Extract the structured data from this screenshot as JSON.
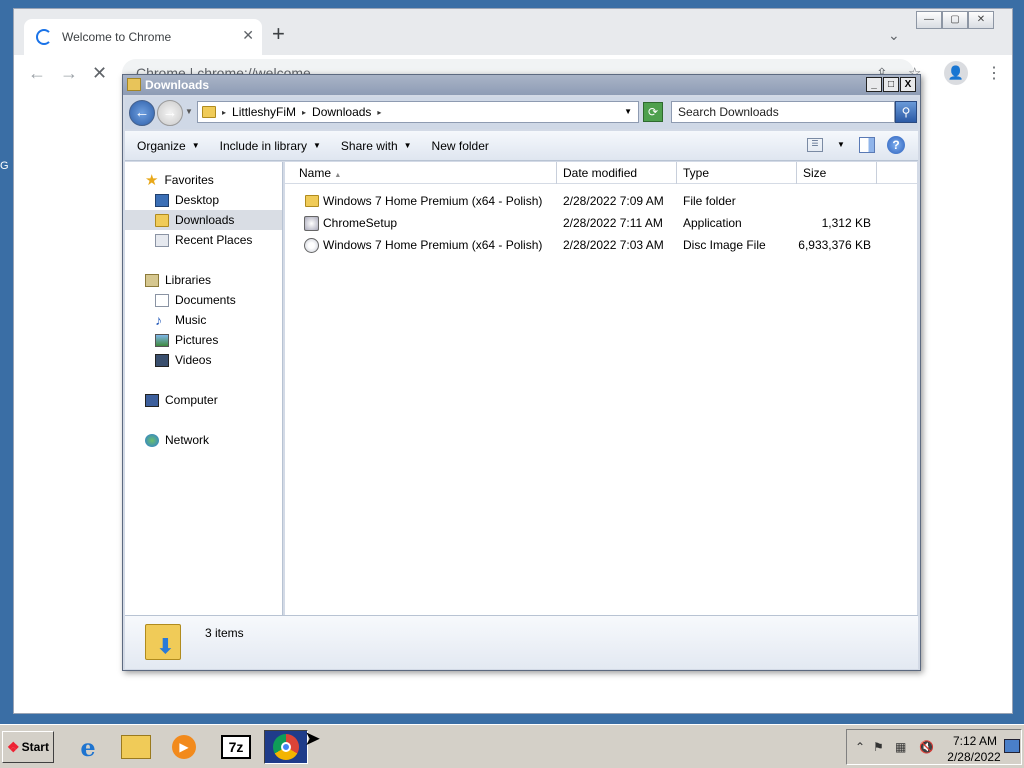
{
  "chrome": {
    "tab_title": "Welcome to Chrome",
    "new_tab": "+",
    "tab_close": "✕",
    "tabs_dropdown": "⌄",
    "minimize": "—",
    "maximize": "▢",
    "close": "✕",
    "back": "←",
    "forward": "→",
    "stop": "✕",
    "omnibox_text": "Chrome  |  chrome://welcome",
    "share": "⇪",
    "bookmark": "☆",
    "profile": "👤",
    "menu": "⋮"
  },
  "explorer": {
    "title": "Downloads",
    "ctrl_min": "_",
    "ctrl_max": "□",
    "ctrl_close": "X",
    "breadcrumb": [
      "LittleshyFiM",
      "Downloads"
    ],
    "search_placeholder": "Search Downloads",
    "commands": [
      "Organize",
      "Include in library",
      "Share with",
      "New folder"
    ],
    "help": "?",
    "nav": {
      "favorites_label": "Favorites",
      "favorites": [
        "Desktop",
        "Downloads",
        "Recent Places"
      ],
      "libraries_label": "Libraries",
      "libraries": [
        "Documents",
        "Music",
        "Pictures",
        "Videos"
      ],
      "computer": "Computer",
      "network": "Network"
    },
    "columns": [
      "Name",
      "Date modified",
      "Type",
      "Size"
    ],
    "files": [
      {
        "name": "Windows 7 Home Premium (x64 - Polish)",
        "date": "2/28/2022 7:09 AM",
        "type": "File folder",
        "size": ""
      },
      {
        "name": "ChromeSetup",
        "date": "2/28/2022 7:11 AM",
        "type": "Application",
        "size": "1,312 KB"
      },
      {
        "name": "Windows 7 Home Premium (x64 - Polish)",
        "date": "2/28/2022 7:03 AM",
        "type": "Disc Image File",
        "size": "6,933,376 KB"
      }
    ],
    "item_count": "3 items"
  },
  "taskbar": {
    "start_label": "Start",
    "apps": [
      "internet-explorer",
      "file-explorer",
      "media-player",
      "7-zip",
      "chrome"
    ],
    "sevenzip_label": "7z",
    "time": "7:12 AM",
    "date": "2/28/2022"
  },
  "desktop_text": "G"
}
